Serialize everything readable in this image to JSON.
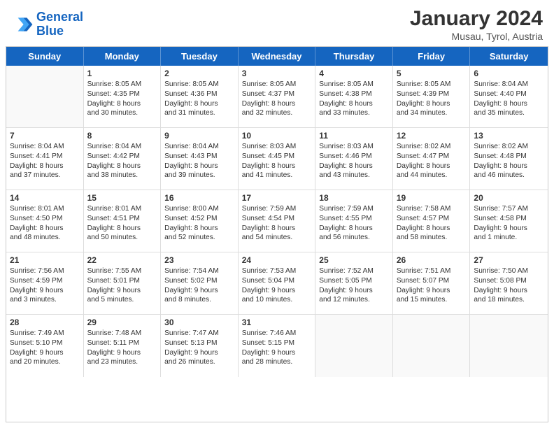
{
  "header": {
    "logo_text_1": "General",
    "logo_text_2": "Blue",
    "month_title": "January 2024",
    "location": "Musau, Tyrol, Austria"
  },
  "days_of_week": [
    "Sunday",
    "Monday",
    "Tuesday",
    "Wednesday",
    "Thursday",
    "Friday",
    "Saturday"
  ],
  "weeks": [
    [
      {
        "day": "",
        "empty": true
      },
      {
        "day": "1",
        "rise": "8:05 AM",
        "set": "4:35 PM",
        "daylight": "8 hours and 30 minutes."
      },
      {
        "day": "2",
        "rise": "8:05 AM",
        "set": "4:36 PM",
        "daylight": "8 hours and 31 minutes."
      },
      {
        "day": "3",
        "rise": "8:05 AM",
        "set": "4:37 PM",
        "daylight": "8 hours and 32 minutes."
      },
      {
        "day": "4",
        "rise": "8:05 AM",
        "set": "4:38 PM",
        "daylight": "8 hours and 33 minutes."
      },
      {
        "day": "5",
        "rise": "8:05 AM",
        "set": "4:39 PM",
        "daylight": "8 hours and 34 minutes."
      },
      {
        "day": "6",
        "rise": "8:04 AM",
        "set": "4:40 PM",
        "daylight": "8 hours and 35 minutes."
      }
    ],
    [
      {
        "day": "7",
        "rise": "8:04 AM",
        "set": "4:41 PM",
        "daylight": "8 hours and 37 minutes."
      },
      {
        "day": "8",
        "rise": "8:04 AM",
        "set": "4:42 PM",
        "daylight": "8 hours and 38 minutes."
      },
      {
        "day": "9",
        "rise": "8:04 AM",
        "set": "4:43 PM",
        "daylight": "8 hours and 39 minutes."
      },
      {
        "day": "10",
        "rise": "8:03 AM",
        "set": "4:45 PM",
        "daylight": "8 hours and 41 minutes."
      },
      {
        "day": "11",
        "rise": "8:03 AM",
        "set": "4:46 PM",
        "daylight": "8 hours and 43 minutes."
      },
      {
        "day": "12",
        "rise": "8:02 AM",
        "set": "4:47 PM",
        "daylight": "8 hours and 44 minutes."
      },
      {
        "day": "13",
        "rise": "8:02 AM",
        "set": "4:48 PM",
        "daylight": "8 hours and 46 minutes."
      }
    ],
    [
      {
        "day": "14",
        "rise": "8:01 AM",
        "set": "4:50 PM",
        "daylight": "8 hours and 48 minutes."
      },
      {
        "day": "15",
        "rise": "8:01 AM",
        "set": "4:51 PM",
        "daylight": "8 hours and 50 minutes."
      },
      {
        "day": "16",
        "rise": "8:00 AM",
        "set": "4:52 PM",
        "daylight": "8 hours and 52 minutes."
      },
      {
        "day": "17",
        "rise": "7:59 AM",
        "set": "4:54 PM",
        "daylight": "8 hours and 54 minutes."
      },
      {
        "day": "18",
        "rise": "7:59 AM",
        "set": "4:55 PM",
        "daylight": "8 hours and 56 minutes."
      },
      {
        "day": "19",
        "rise": "7:58 AM",
        "set": "4:57 PM",
        "daylight": "8 hours and 58 minutes."
      },
      {
        "day": "20",
        "rise": "7:57 AM",
        "set": "4:58 PM",
        "daylight": "9 hours and 1 minute."
      }
    ],
    [
      {
        "day": "21",
        "rise": "7:56 AM",
        "set": "4:59 PM",
        "daylight": "9 hours and 3 minutes."
      },
      {
        "day": "22",
        "rise": "7:55 AM",
        "set": "5:01 PM",
        "daylight": "9 hours and 5 minutes."
      },
      {
        "day": "23",
        "rise": "7:54 AM",
        "set": "5:02 PM",
        "daylight": "9 hours and 8 minutes."
      },
      {
        "day": "24",
        "rise": "7:53 AM",
        "set": "5:04 PM",
        "daylight": "9 hours and 10 minutes."
      },
      {
        "day": "25",
        "rise": "7:52 AM",
        "set": "5:05 PM",
        "daylight": "9 hours and 12 minutes."
      },
      {
        "day": "26",
        "rise": "7:51 AM",
        "set": "5:07 PM",
        "daylight": "9 hours and 15 minutes."
      },
      {
        "day": "27",
        "rise": "7:50 AM",
        "set": "5:08 PM",
        "daylight": "9 hours and 18 minutes."
      }
    ],
    [
      {
        "day": "28",
        "rise": "7:49 AM",
        "set": "5:10 PM",
        "daylight": "9 hours and 20 minutes."
      },
      {
        "day": "29",
        "rise": "7:48 AM",
        "set": "5:11 PM",
        "daylight": "9 hours and 23 minutes."
      },
      {
        "day": "30",
        "rise": "7:47 AM",
        "set": "5:13 PM",
        "daylight": "9 hours and 26 minutes."
      },
      {
        "day": "31",
        "rise": "7:46 AM",
        "set": "5:15 PM",
        "daylight": "9 hours and 28 minutes."
      },
      {
        "day": "",
        "empty": true
      },
      {
        "day": "",
        "empty": true
      },
      {
        "day": "",
        "empty": true
      }
    ]
  ]
}
